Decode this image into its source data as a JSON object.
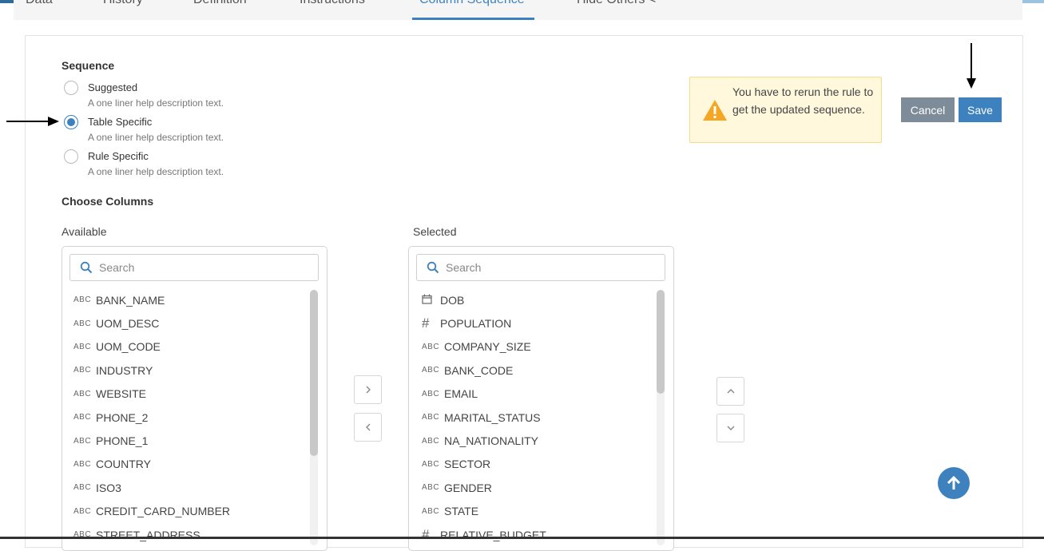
{
  "tabs": [
    {
      "label": "Data"
    },
    {
      "label": "History"
    },
    {
      "label": "Definition"
    },
    {
      "label": "Instructions"
    },
    {
      "label": "Column Sequence",
      "active": true
    },
    {
      "label": "Hide Others <"
    }
  ],
  "sequence": {
    "title": "Sequence",
    "options": [
      {
        "label": "Suggested",
        "help": "A one liner help description text.",
        "checked": false
      },
      {
        "label": "Table Specific",
        "help": "A one liner help description text.",
        "checked": true
      },
      {
        "label": "Rule Specific",
        "help": "A one liner help description text.",
        "checked": false
      }
    ]
  },
  "warning": {
    "text": "You have to rerun the rule to get the updated sequence.",
    "icon": "warning-icon",
    "color": "#f5a623"
  },
  "buttons": {
    "cancel_label": "Cancel",
    "save_label": "Save"
  },
  "choose_columns": {
    "title": "Choose Columns",
    "available": {
      "label": "Available",
      "search_placeholder": "Search",
      "items": [
        {
          "type": "ABC",
          "name": "BANK_NAME"
        },
        {
          "type": "ABC",
          "name": "UOM_DESC"
        },
        {
          "type": "ABC",
          "name": "UOM_CODE"
        },
        {
          "type": "ABC",
          "name": "INDUSTRY"
        },
        {
          "type": "ABC",
          "name": "WEBSITE"
        },
        {
          "type": "ABC",
          "name": "PHONE_2"
        },
        {
          "type": "ABC",
          "name": "PHONE_1"
        },
        {
          "type": "ABC",
          "name": "COUNTRY"
        },
        {
          "type": "ABC",
          "name": "ISO3"
        },
        {
          "type": "ABC",
          "name": "CREDIT_CARD_NUMBER"
        },
        {
          "type": "ABC",
          "name": "STREET_ADDRESS"
        }
      ]
    },
    "selected": {
      "label": "Selected",
      "search_placeholder": "Search",
      "items": [
        {
          "type": "date",
          "name": "DOB"
        },
        {
          "type": "number",
          "name": "POPULATION"
        },
        {
          "type": "ABC",
          "name": "COMPANY_SIZE"
        },
        {
          "type": "ABC",
          "name": "BANK_CODE"
        },
        {
          "type": "ABC",
          "name": "EMAIL"
        },
        {
          "type": "ABC",
          "name": "MARITAL_STATUS"
        },
        {
          "type": "ABC",
          "name": "NA_NATIONALITY"
        },
        {
          "type": "ABC",
          "name": "SECTOR"
        },
        {
          "type": "ABC",
          "name": "GENDER"
        },
        {
          "type": "ABC",
          "name": "STATE"
        },
        {
          "type": "number",
          "name": "RELATIVE_BUDGET"
        }
      ]
    }
  },
  "colors": {
    "accent": "#3d82bf",
    "cancel": "#7e8c99",
    "warning_bg": "#fff8dc"
  }
}
